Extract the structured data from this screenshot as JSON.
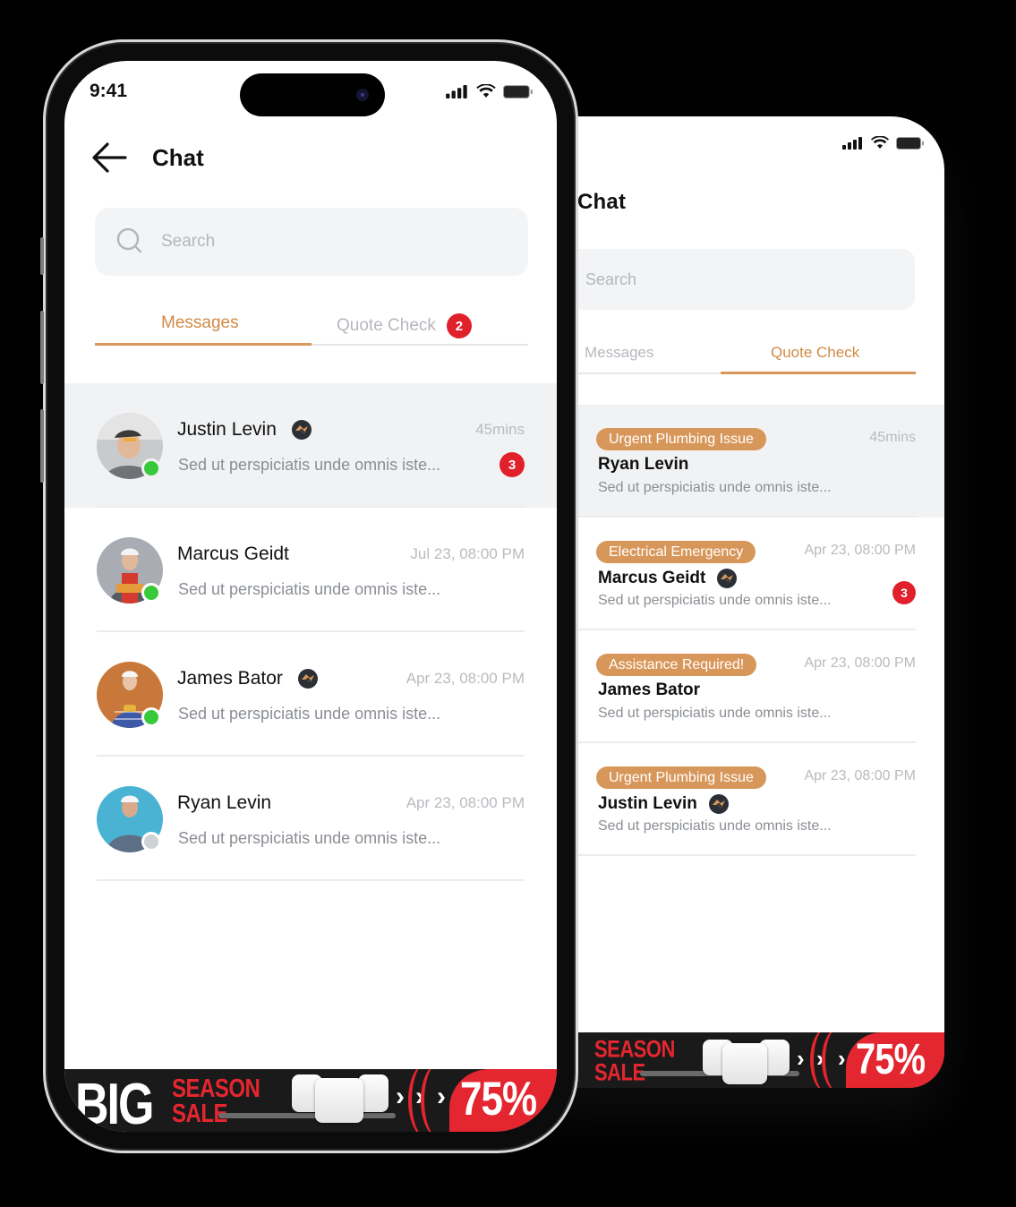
{
  "colors": {
    "accent": "#D8975A",
    "accent_text": "#D08A45",
    "badge_red": "#E0202A",
    "online_green": "#38C93A",
    "offline_gray": "#CED2D6",
    "banner_red": "#E3262F"
  },
  "front_phone": {
    "status_bar": {
      "time": "9:41",
      "icons": [
        "signal-icon",
        "wifi-icon",
        "battery-icon"
      ]
    },
    "header": {
      "back_icon": "arrow-left-icon",
      "title": "Chat"
    },
    "search": {
      "placeholder": "Search",
      "value": "",
      "icon": "search-icon"
    },
    "tabs": [
      {
        "label": "Messages",
        "active": true,
        "badge": null
      },
      {
        "label": "Quote Check",
        "active": false,
        "badge": "2"
      }
    ],
    "conversations": [
      {
        "name": "Justin Levin",
        "verified": true,
        "time": "45mins",
        "preview": "Sed ut perspiciatis unde omnis iste...",
        "unread": "3",
        "online": true,
        "highlighted": true
      },
      {
        "name": "Marcus Geidt",
        "verified": false,
        "time": "Jul 23, 08:00 PM",
        "preview": "Sed ut perspiciatis unde omnis iste...",
        "unread": null,
        "online": true,
        "highlighted": false
      },
      {
        "name": "James Bator",
        "verified": true,
        "time": "Apr 23, 08:00 PM",
        "preview": "Sed ut perspiciatis unde omnis iste...",
        "unread": null,
        "online": true,
        "highlighted": false
      },
      {
        "name": "Ryan Levin",
        "verified": false,
        "time": "Apr 23, 08:00 PM",
        "preview": "Sed ut perspiciatis unde omnis iste...",
        "unread": null,
        "online": false,
        "highlighted": false
      }
    ],
    "banner": {
      "big": "BIG",
      "line1": "SEASON",
      "line2": "SALE",
      "discount": "75%"
    }
  },
  "back_phone": {
    "status_bar": {
      "icons": [
        "signal-icon",
        "wifi-icon",
        "battery-icon"
      ]
    },
    "header": {
      "title": "Chat"
    },
    "search": {
      "placeholder": "Search"
    },
    "tabs": [
      {
        "label": "Messages",
        "active": false
      },
      {
        "label": "Quote Check",
        "active": true
      }
    ],
    "quotes": [
      {
        "tag": "Urgent Plumbing Issue",
        "name": "Ryan Levin",
        "verified": false,
        "time": "45mins",
        "preview": "Sed ut perspiciatis unde omnis iste...",
        "unread": null,
        "highlighted": true
      },
      {
        "tag": "Electrical Emergency",
        "name": "Marcus Geidt",
        "verified": true,
        "time": "Apr 23, 08:00 PM",
        "preview": "Sed ut perspiciatis unde omnis iste...",
        "unread": "3",
        "highlighted": false
      },
      {
        "tag": "Assistance Required!",
        "name": "James Bator",
        "verified": false,
        "time": "Apr 23, 08:00 PM",
        "preview": "Sed ut perspiciatis unde omnis iste...",
        "unread": null,
        "highlighted": false
      },
      {
        "tag": "Urgent Plumbing Issue",
        "name": "Justin Levin",
        "verified": true,
        "time": "Apr 23, 08:00 PM",
        "preview": "Sed ut perspiciatis unde omnis iste...",
        "unread": null,
        "highlighted": false
      }
    ],
    "banner": {
      "line1": "SEASON",
      "line2": "SALE",
      "discount": "75%"
    }
  }
}
